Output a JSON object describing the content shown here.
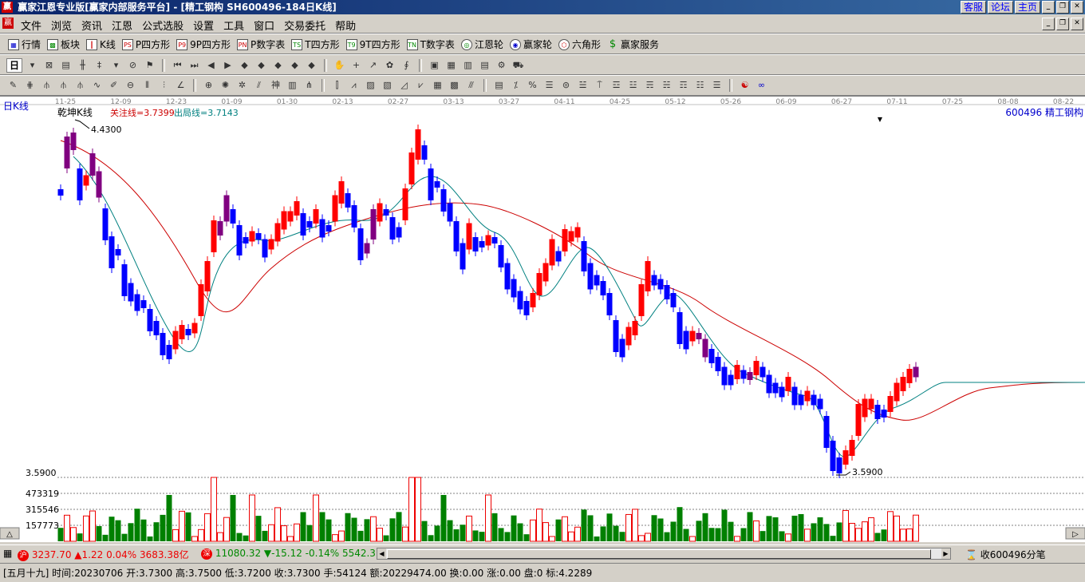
{
  "window": {
    "title": "赢家江恩专业版[赢家内部服务平台] - [精工钢构  SH600496-184日K线]",
    "right_buttons": [
      "客服",
      "论坛",
      "主页"
    ]
  },
  "menu": [
    "文件",
    "浏览",
    "资讯",
    "江恩",
    "公式选股",
    "设置",
    "工具",
    "窗口",
    "交易委托",
    "帮助"
  ],
  "toolbar1": [
    {
      "icon": "quote-icon",
      "label": "行情"
    },
    {
      "icon": "sector-icon",
      "label": "板块"
    },
    {
      "icon": "kline-icon",
      "label": "K线"
    },
    {
      "icon": "ps-icon",
      "label": "P四方形"
    },
    {
      "icon": "p9-icon",
      "label": "9P四方形"
    },
    {
      "icon": "pn-icon",
      "label": "P数字表"
    },
    {
      "icon": "ts-icon",
      "label": "T四方形"
    },
    {
      "icon": "t9-icon",
      "label": "9T四方形"
    },
    {
      "icon": "tn-icon",
      "label": "T数字表"
    },
    {
      "icon": "gann-wheel-icon",
      "label": "江恩轮"
    },
    {
      "icon": "winner-wheel-icon",
      "label": "赢家轮"
    },
    {
      "icon": "hexagon-icon",
      "label": "六角形"
    },
    {
      "icon": "dollar-icon",
      "label": "赢家服务"
    }
  ],
  "period_selector": "日",
  "chart": {
    "period_label": "日K线",
    "indicator_name": "乾坤K线",
    "focus_line": "关注线=3.7399",
    "exit_line": "出局线=3.7143",
    "stock": "600496  精工钢构",
    "high_label": "4.4300",
    "low_label": "3.5900",
    "price_axis_label": "3.5900",
    "volume_ticks": [
      "473319",
      "315546",
      "157773"
    ],
    "date_ticks": [
      "11-25",
      "12-09",
      "12-23",
      "01-09",
      "01-30",
      "02-13",
      "02-27",
      "03-13",
      "03-27",
      "04-11",
      "04-25",
      "05-12",
      "05-26",
      "06-09",
      "06-27",
      "07-11",
      "07-25",
      "08-08",
      "08-22"
    ],
    "colors": {
      "up": "#ff0000",
      "down": "#0000ff",
      "neutral": "#800080",
      "ma_slow": "#cc0000",
      "ma_fast": "#008080",
      "volume": "#008000"
    }
  },
  "chart_data": {
    "type": "candlestick",
    "stock_code": "600496",
    "high": 4.43,
    "low": 3.59,
    "focus_line": 3.7399,
    "exit_line": 3.7143,
    "volume_axis_ticks": [
      473319,
      315546,
      157773
    ]
  },
  "status": {
    "sh_badge": "沪",
    "sh_index": "3237.70",
    "sh_change": "▲1.22",
    "sh_pct": "0.04%",
    "sh_amount": "3683.38亿",
    "sz_badge": "深",
    "sz_index": "11080.32",
    "sz_change": "▼-15.12",
    "sz_pct": "-0.14%",
    "sz_amount": "5542.3",
    "right": "收600496分笔"
  },
  "bottom": {
    "info": "[五月十九] 时间:20230706 开:3.7300 高:3.7500 低:3.7200 收:3.7300 手:54124 额:20229474.00 换:0.00 涨:0.00 盘:0 标:4.2289"
  }
}
